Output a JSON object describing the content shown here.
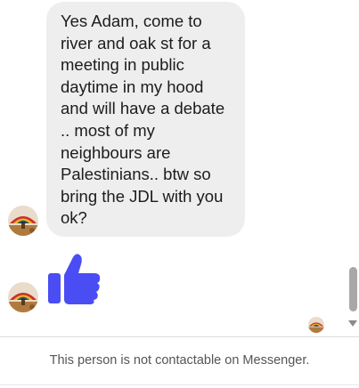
{
  "conversation": {
    "messages": [
      {
        "sender": "other",
        "avatar_icon": "user-avatar-icon",
        "text": "Yes Adam, come to\nriver and oak st for a\nmeeting in public\ndaytime in my hood\nand will have a debate\n.. most of my\nneighbours are\nPalestinians.. btw so\nbring the JDL with you\nok?"
      },
      {
        "sender": "other",
        "avatar_icon": "user-avatar-icon",
        "reaction": "thumbs-up-icon"
      }
    ],
    "read_receipt_icon": "seen-avatar-icon"
  },
  "footer": {
    "notice": "This person is not contactable on Messenger."
  },
  "colors": {
    "bubble_background": "#eeeeee",
    "like_blue": "#4a4df4",
    "notice_text": "#555555"
  }
}
